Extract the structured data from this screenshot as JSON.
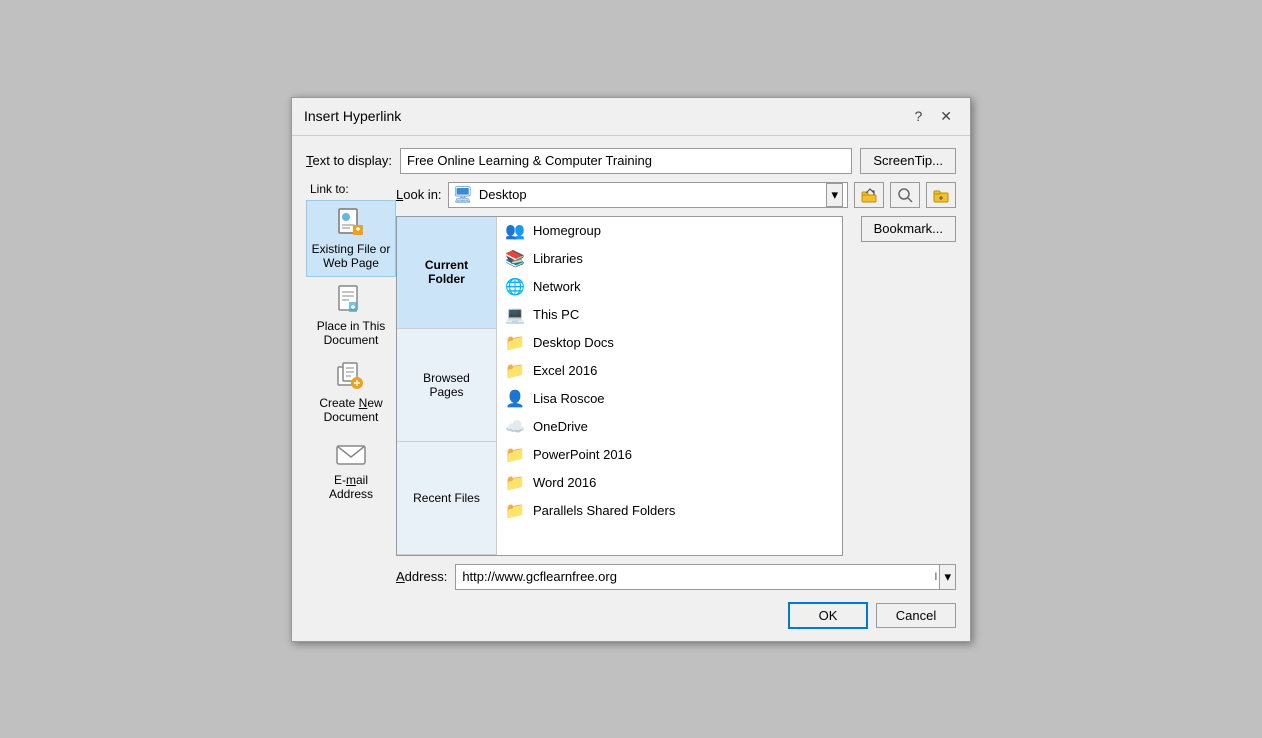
{
  "dialog": {
    "title": "Insert Hyperlink",
    "help_btn": "?",
    "close_btn": "✕"
  },
  "header": {
    "text_display_label": "Text to display:",
    "text_display_value": "Free Online Learning & Computer Training",
    "screentip_label": "ScreenTip..."
  },
  "link_to": {
    "label": "Link to:",
    "items": [
      {
        "id": "existing",
        "label": "Existing File or Web Page",
        "icon": "📄",
        "selected": true
      },
      {
        "id": "place",
        "label": "Place in This Document",
        "icon": "📋",
        "selected": false
      },
      {
        "id": "new",
        "label": "Create New Document",
        "icon": "📝",
        "selected": false
      },
      {
        "id": "email",
        "label": "E-mail Address",
        "icon": "✉",
        "selected": false
      }
    ]
  },
  "lookin": {
    "label": "Look in:",
    "value": "Desktop",
    "icon": "🖥"
  },
  "nav_items": [
    {
      "id": "current",
      "label": "Current Folder",
      "active": true
    },
    {
      "id": "browsed",
      "label": "Browsed Pages",
      "active": false
    },
    {
      "id": "recent",
      "label": "Recent Files",
      "active": false
    }
  ],
  "file_list": [
    {
      "name": "Homegroup",
      "icon": "homegroup"
    },
    {
      "name": "Libraries",
      "icon": "library"
    },
    {
      "name": "Network",
      "icon": "network"
    },
    {
      "name": "This PC",
      "icon": "computer"
    },
    {
      "name": "Desktop Docs",
      "icon": "folder"
    },
    {
      "name": "Excel 2016",
      "icon": "folder"
    },
    {
      "name": "Lisa Roscoe",
      "icon": "user"
    },
    {
      "name": "OneDrive",
      "icon": "onedrive"
    },
    {
      "name": "PowerPoint 2016",
      "icon": "folder"
    },
    {
      "name": "Word 2016",
      "icon": "folder"
    },
    {
      "name": "Parallels Shared Folders",
      "icon": "folder"
    }
  ],
  "address": {
    "label": "Address:",
    "value": "http://www.gcflearnfree.org"
  },
  "buttons": {
    "bookmark": "Bookmark...",
    "ok": "OK",
    "cancel": "Cancel"
  }
}
